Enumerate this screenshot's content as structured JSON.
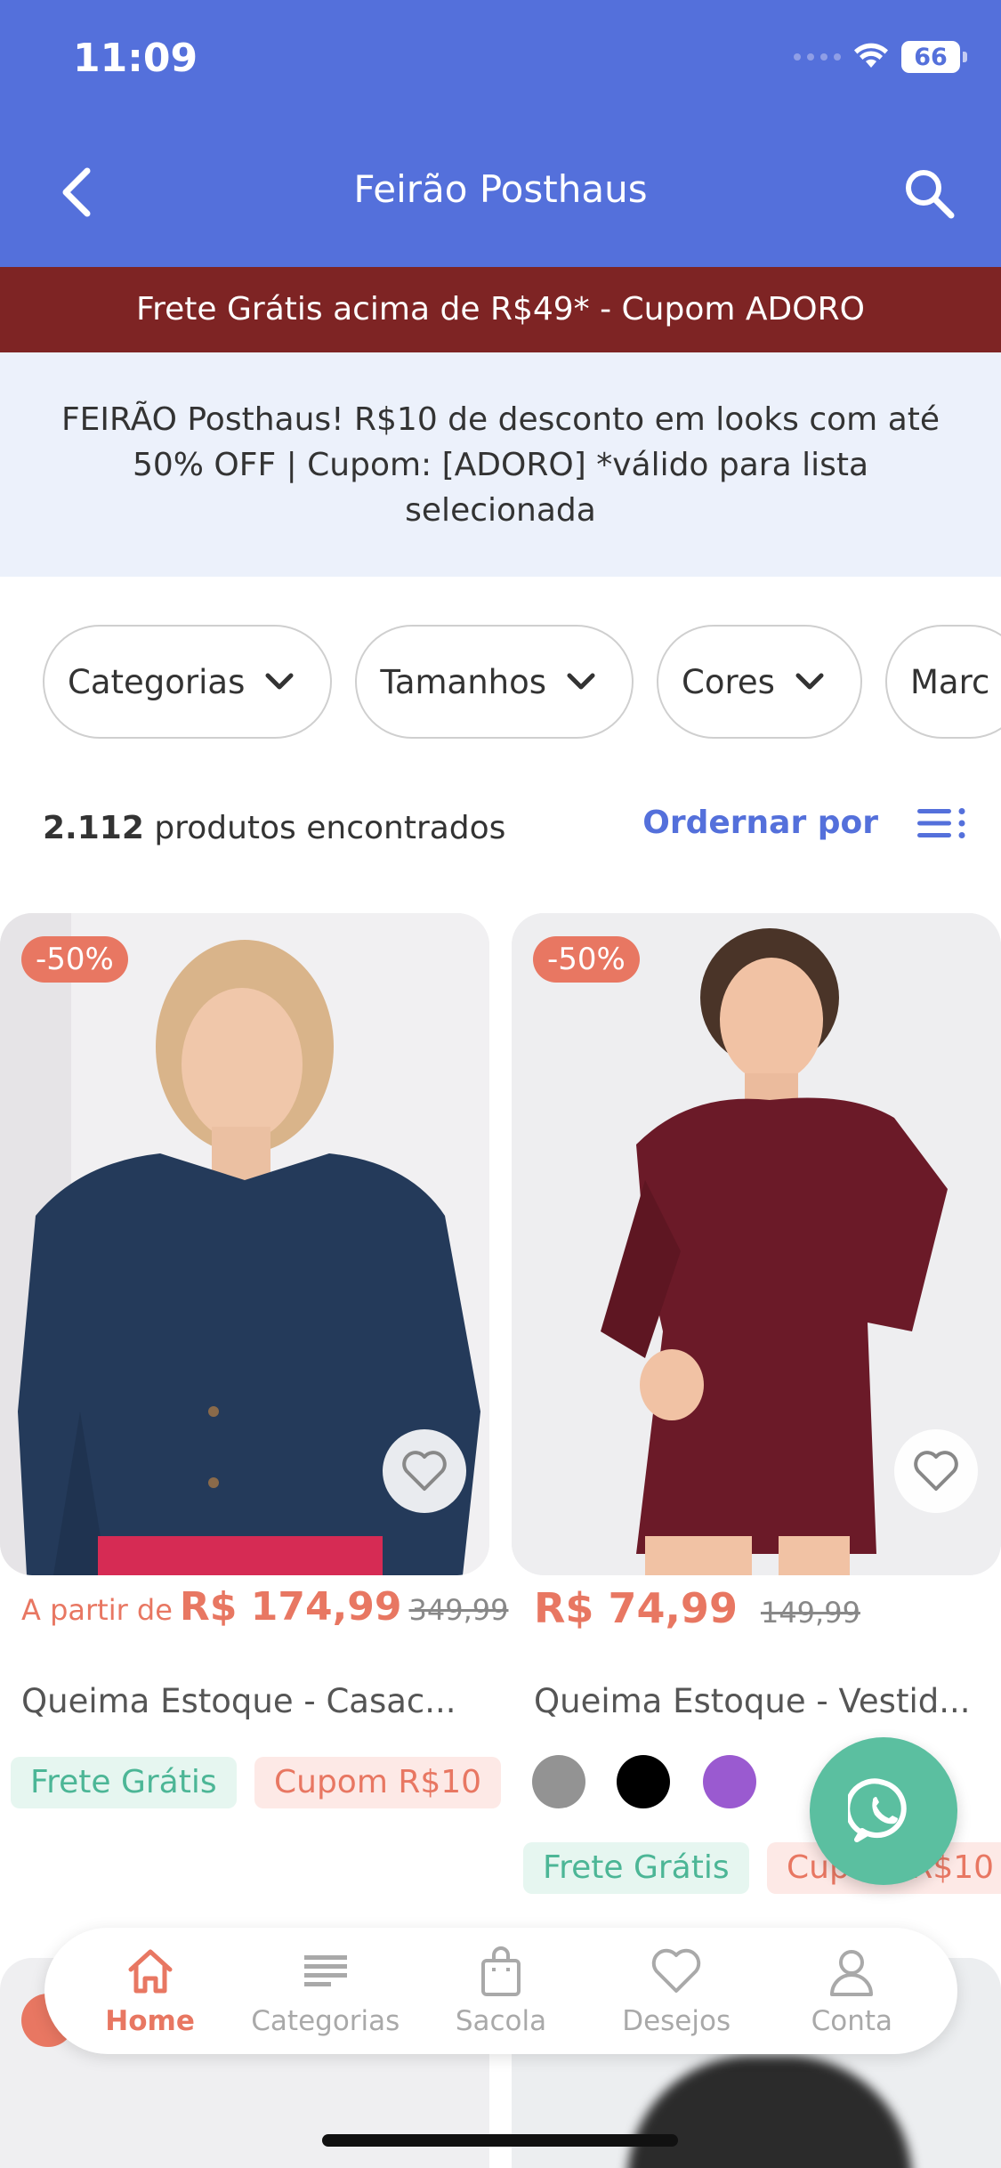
{
  "status_bar": {
    "time": "11:09",
    "battery": "66"
  },
  "header": {
    "title": "Feirão Posthaus"
  },
  "promo_strip": {
    "text": "Frete Grátis acima de R$49* - Cupom ADORO"
  },
  "info_banner": {
    "text": "FEIRÃO Posthaus! R$10 de desconto em looks com até 50% OFF | Cupom: [ADORO] *válido para lista selecionada"
  },
  "filters": [
    {
      "label": "Categorias"
    },
    {
      "label": "Tamanhos"
    },
    {
      "label": "Cores"
    },
    {
      "label": "Marc"
    }
  ],
  "results": {
    "count": "2.112",
    "suffix": "produtos encontrados",
    "sort_label": "Ordernar por"
  },
  "products": [
    {
      "discount": "-50%",
      "price_prefix": "A partir de",
      "price": "R$ 174,99",
      "old_price": "349,99",
      "name": "Queima Estoque - Casac...",
      "tags": [
        "Frete Grátis",
        "Cupom R$10"
      ],
      "swatches": []
    },
    {
      "discount": "-50%",
      "price_prefix": "",
      "price": "R$ 74,99",
      "old_price": "149,99",
      "name": "Queima Estoque - Vestid...",
      "tags": [
        "Frete Grátis",
        "Cupom R$10"
      ],
      "swatches": [
        "#939393",
        "#000000",
        "#9a5ad0"
      ]
    }
  ],
  "bottom_nav": [
    {
      "label": "Home",
      "icon": "home-icon",
      "active": true
    },
    {
      "label": "Categorias",
      "icon": "list-icon",
      "active": false
    },
    {
      "label": "Sacola",
      "icon": "bag-icon",
      "active": false
    },
    {
      "label": "Desejos",
      "icon": "heart-icon",
      "active": false
    },
    {
      "label": "Conta",
      "icon": "user-icon",
      "active": false
    }
  ],
  "colors": {
    "brand_blue": "#5470db",
    "promo_red": "#7e2424",
    "accent_salmon": "#e87762",
    "tag_green": "#4cb696",
    "whatsapp_green": "#5bbfa0"
  }
}
